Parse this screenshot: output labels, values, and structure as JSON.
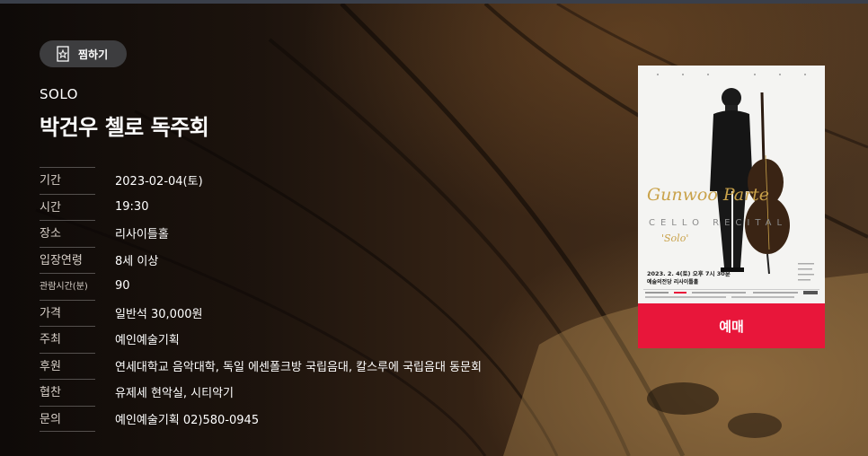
{
  "wish": {
    "label": "찜하기",
    "icon": "star-page-icon"
  },
  "performance": {
    "genre": "SOLO",
    "title": "박건우 첼로 독주회"
  },
  "info": [
    {
      "key": "기간",
      "value": "2023-02-04(토)"
    },
    {
      "key": "시간",
      "value": "19:30"
    },
    {
      "key": "장소",
      "value": "리사이틀홀"
    },
    {
      "key": "입장연령",
      "value": "8세 이상"
    },
    {
      "key": "관람시간(분)",
      "value": "90"
    },
    {
      "key": "가격",
      "value": "일반석 30,000원"
    },
    {
      "key": "주최",
      "value": "예인예술기획"
    },
    {
      "key": "후원",
      "value": "연세대학교 음악대학, 독일 에센폴크방 국립음대, 칼스루에 국립음대 동문회"
    },
    {
      "key": "협찬",
      "value": "유제세 현악실, 시티악기"
    },
    {
      "key": "문의",
      "value": "예인예술기획 02)580-0945"
    }
  ],
  "poster": {
    "script_name": "Gunwoo Parte",
    "subtitle": "CELLO RECITAL",
    "tagline": "'Solo'",
    "date_line": "2023. 2. 4(토) 오후 7시 30분",
    "venue_line": "예술의전당 리사이틀홀"
  },
  "booking": {
    "label": "예매"
  },
  "colors": {
    "accent": "#e8163a",
    "button_bg": "#3d3d3f",
    "poster_gold": "#c9a24a"
  }
}
